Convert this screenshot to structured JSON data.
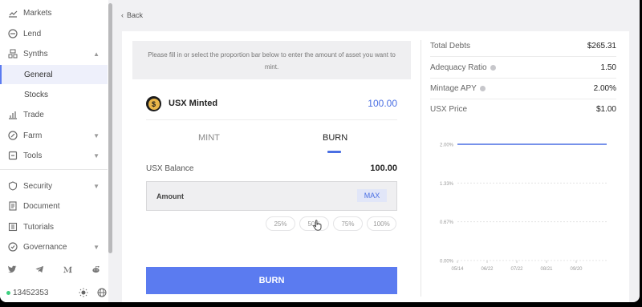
{
  "sidebar": {
    "items": [
      {
        "label": "Markets",
        "icon": "markets-icon"
      },
      {
        "label": "Lend",
        "icon": "lend-icon"
      },
      {
        "label": "Synths",
        "icon": "synths-icon"
      },
      {
        "label": "General"
      },
      {
        "label": "Stocks"
      },
      {
        "label": "Trade",
        "icon": "trade-icon"
      },
      {
        "label": "Farm",
        "icon": "farm-icon"
      },
      {
        "label": "Tools",
        "icon": "tools-icon"
      },
      {
        "label": "Security",
        "icon": "security-icon"
      },
      {
        "label": "Document",
        "icon": "document-icon"
      },
      {
        "label": "Tutorials",
        "icon": "tutorials-icon"
      },
      {
        "label": "Governance",
        "icon": "governance-icon"
      }
    ],
    "block_number": "13452353"
  },
  "back_label": "Back",
  "notice": "Please fill in or select the proportion bar below to enter the amount of asset you want to mint.",
  "usx": {
    "label": "USX Minted",
    "amount": "100.00",
    "symbol": "$"
  },
  "tabs": [
    {
      "label": "MINT"
    },
    {
      "label": "BURN"
    }
  ],
  "balance": {
    "label": "USX Balance",
    "value": "100.00"
  },
  "amount": {
    "label": "Amount",
    "max_label": "MAX"
  },
  "percent_buttons": [
    "25%",
    "50%",
    "75%",
    "100%"
  ],
  "submit_label": "BURN",
  "stats": [
    {
      "label": "Total Debts",
      "value": "$265.31"
    },
    {
      "label": "Adequacy Ratio",
      "value": "1.50"
    },
    {
      "label": "Mintage APY",
      "value": "2.00%"
    },
    {
      "label": "USX Price",
      "value": "$1.00"
    }
  ],
  "colors": {
    "accent": "#5b7bf0",
    "accent_text": "#4a6fe3",
    "status_online": "#3ccf7f"
  },
  "chart_data": {
    "type": "line",
    "x": [
      "05/14",
      "06/22",
      "07/22",
      "08/21",
      "09/20"
    ],
    "y_ticks": [
      "2.00%",
      "1.33%",
      "0.67%",
      "0.00%"
    ],
    "ylim": [
      0,
      2
    ],
    "series": [
      {
        "values": [
          2.0,
          2.0,
          2.0,
          2.0,
          2.0,
          2.0
        ]
      }
    ],
    "grid": true
  }
}
